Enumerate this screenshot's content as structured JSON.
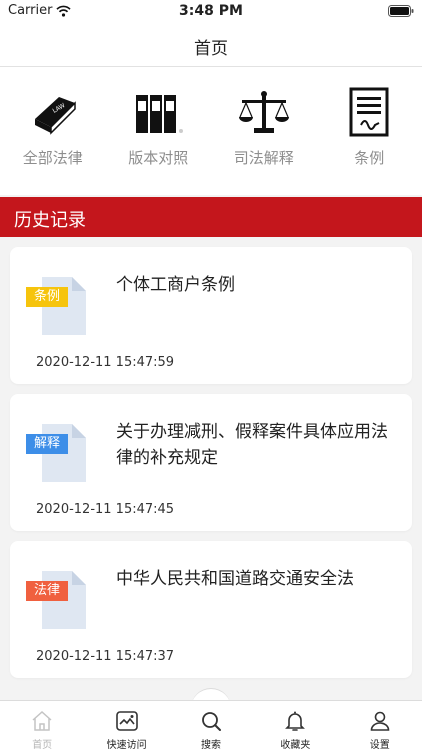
{
  "status_bar": {
    "carrier": "Carrier",
    "time": "3:48 PM"
  },
  "header": {
    "title": "首页"
  },
  "categories": [
    {
      "label": "全部法律",
      "icon": "law-book-icon"
    },
    {
      "label": "版本对照",
      "icon": "law-books-icon"
    },
    {
      "label": "司法解释",
      "icon": "scales-icon"
    },
    {
      "label": "条例",
      "icon": "document-icon"
    }
  ],
  "history": {
    "title": "历史记录",
    "items": [
      {
        "tag": "条例",
        "tag_color": "#f6c40d",
        "title": "个体工商户条例",
        "time": "2020-12-11 15:47:59"
      },
      {
        "tag": "解释",
        "tag_color": "#3d8ee8",
        "title": "关于办理减刑、假释案件具体应用法律的补充规定",
        "time": "2020-12-11 15:47:45"
      },
      {
        "tag": "法律",
        "tag_color": "#f0603f",
        "title": "中华人民共和国道路交通安全法",
        "time": "2020-12-11 15:47:37"
      }
    ]
  },
  "tabs": [
    {
      "label": "首页",
      "icon": "home-icon",
      "active": false
    },
    {
      "label": "快速访问",
      "icon": "quick-access-icon",
      "active": true
    },
    {
      "label": "搜索",
      "icon": "search-icon",
      "active": true
    },
    {
      "label": "收藏夹",
      "icon": "bell-icon",
      "active": true
    },
    {
      "label": "设置",
      "icon": "user-icon",
      "active": true
    }
  ],
  "colors": {
    "accent": "#c4161c",
    "background": "#f3f3f3"
  }
}
